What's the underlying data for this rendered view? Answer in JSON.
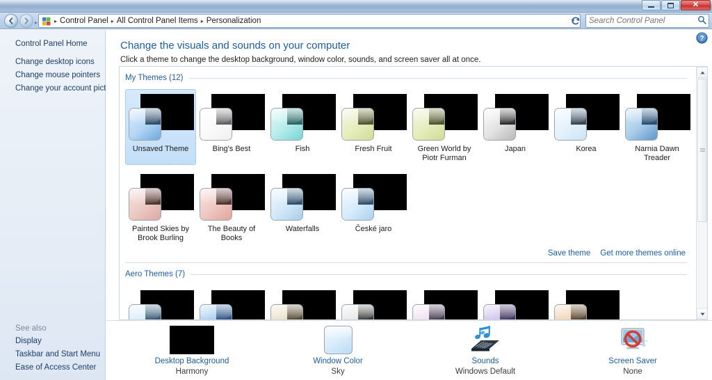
{
  "window": {
    "minimize_label": "Minimize",
    "maximize_label": "Maximize",
    "close_label": "Close"
  },
  "nav": {
    "back_label": "Back",
    "forward_label": "Forward",
    "refresh_label": "Refresh",
    "dropdown_label": "Previous locations",
    "breadcrumb": [
      "Control Panel",
      "All Control Panel Items",
      "Personalization"
    ],
    "separator": "▸"
  },
  "search": {
    "placeholder": "Search Control Panel",
    "value": "",
    "icon": "search-icon"
  },
  "sidebar": {
    "home_label": "Control Panel Home",
    "items": [
      {
        "label": "Change desktop icons"
      },
      {
        "label": "Change mouse pointers"
      },
      {
        "label": "Change your account picture"
      }
    ],
    "see_also_heading": "See also",
    "see_also": [
      {
        "label": "Display"
      },
      {
        "label": "Taskbar and Start Menu"
      },
      {
        "label": "Ease of Access Center"
      }
    ]
  },
  "main": {
    "title": "Change the visuals and sounds on your computer",
    "subtitle": "Click a theme to change the desktop background, window color, sounds, and screen saver all at once.",
    "help_label": "Help",
    "sections": [
      {
        "id": "my-themes",
        "heading": "My Themes (12)",
        "rows": [
          [
            {
              "name": "Unsaved Theme",
              "selected": true,
              "color_light": "#dcebfb",
              "color_mid": "#b5d6f5",
              "color_deep": "#6fa8dc",
              "dark_top": "#7d95ac",
              "dark_bottom": "#2e4a66"
            },
            {
              "name": "Bing's Best",
              "selected": false,
              "color_light": "#ffffff",
              "color_mid": "#fafafa",
              "color_deep": "#f0f0f0",
              "dark_top": "#b9b9b9",
              "dark_bottom": "#5c5c5c"
            },
            {
              "name": "Fish",
              "selected": false,
              "color_light": "#e4f8f8",
              "color_mid": "#b8ecec",
              "color_deep": "#76d6d4",
              "dark_top": "#79b5b2",
              "dark_bottom": "#29615f"
            },
            {
              "name": "Fresh Fruit",
              "selected": false,
              "color_light": "#f3f6de",
              "color_mid": "#e6edbf",
              "color_deep": "#d2dd96",
              "dark_top": "#9fa472",
              "dark_bottom": "#4e5130"
            },
            {
              "name": "Green World by Piotr Furman",
              "selected": false,
              "color_light": "#f2f5dc",
              "color_mid": "#e5edbd",
              "color_deep": "#d0dc94",
              "dark_top": "#9ea371",
              "dark_bottom": "#4d5030"
            },
            {
              "name": "Japan",
              "selected": false,
              "color_light": "#fafafa",
              "color_mid": "#e3e3e3",
              "color_deep": "#b9b9b9",
              "dark_top": "#9a9a9a",
              "dark_bottom": "#272727"
            },
            {
              "name": "Korea",
              "selected": false,
              "color_light": "#f4fafe",
              "color_mid": "#e4f1fb",
              "color_deep": "#cbe4f7",
              "dark_top": "#8fa4b6",
              "dark_bottom": "#313f4c"
            },
            {
              "name": "Narnia Dawn Treader",
              "selected": false,
              "color_light": "#d6e8f8",
              "color_mid": "#a9cdea",
              "color_deep": "#5f96c9",
              "dark_top": "#7196b5",
              "dark_bottom": "#28486a"
            }
          ],
          [
            {
              "name": "Painted Skies by Brook Burling",
              "selected": false,
              "color_light": "#f6e3e0",
              "color_mid": "#eccac4",
              "color_deep": "#dba9a2",
              "dark_top": "#9c7d77",
              "dark_bottom": "#4c332e"
            },
            {
              "name": "The Beauty of Books",
              "selected": false,
              "color_light": "#f8e4e2",
              "color_mid": "#efc8c3",
              "color_deep": "#e0a49c",
              "dark_top": "#9b7b75",
              "dark_bottom": "#4a312c"
            },
            {
              "name": "Waterfalls",
              "selected": false,
              "color_light": "#eef7fe",
              "color_mid": "#d4e9fa",
              "color_deep": "#a9cdea",
              "dark_top": "#7e9cb5",
              "dark_bottom": "#2f4c66"
            },
            {
              "name": "České jaro",
              "selected": false,
              "color_light": "#eef7fe",
              "color_mid": "#d8ecfb",
              "color_deep": "#aed0ed",
              "dark_top": "#7f9db6",
              "dark_bottom": "#304d67"
            }
          ]
        ]
      },
      {
        "id": "aero-themes",
        "heading": "Aero Themes (7)",
        "rows": [
          [
            {
              "name": "",
              "selected": false,
              "color_light": "#eef7fe",
              "color_mid": "#d5eafb",
              "color_deep": "#a8cdea",
              "dark_top": "#7d9bb4",
              "dark_bottom": "#2f4c66"
            },
            {
              "name": "",
              "selected": false,
              "color_light": "#d5e8fa",
              "color_mid": "#9cc6ec",
              "color_deep": "#3f7fc4",
              "dark_top": "#6b94bd",
              "dark_bottom": "#1f4675"
            },
            {
              "name": "",
              "selected": false,
              "color_light": "#f4efe0",
              "color_mid": "#e6dcc2",
              "color_deep": "#cfc19c",
              "dark_top": "#9b8f74",
              "dark_bottom": "#463c28"
            },
            {
              "name": "",
              "selected": false,
              "color_light": "#f6f6f6",
              "color_mid": "#e2e2e2",
              "color_deep": "#bcbcbc",
              "dark_top": "#9c9c9c",
              "dark_bottom": "#2a2a2a"
            },
            {
              "name": "",
              "selected": false,
              "color_light": "#f7f1f8",
              "color_mid": "#ecdcee",
              "color_deep": "#d4bcd9",
              "dark_top": "#8d7d93",
              "dark_bottom": "#3b3042"
            },
            {
              "name": "",
              "selected": false,
              "color_light": "#e6ddf4",
              "color_mid": "#cdbbe8",
              "color_deep": "#9f7fce",
              "dark_top": "#7c6a9b",
              "dark_bottom": "#362a4e"
            },
            {
              "name": "",
              "selected": false,
              "color_light": "#f7e7d4",
              "color_mid": "#edcfae",
              "color_deep": "#ddb184",
              "dark_top": "#9d8164",
              "dark_bottom": "#4a3722"
            }
          ]
        ]
      }
    ],
    "theme_links": [
      {
        "label": "Save theme"
      },
      {
        "label": "Get more themes online"
      }
    ]
  },
  "bottombar": [
    {
      "id": "desktop-background",
      "title": "Desktop Background",
      "value": "Harmony",
      "icon": "picture-icon"
    },
    {
      "id": "window-color",
      "title": "Window Color",
      "value": "Sky",
      "icon": "color-swatch-icon"
    },
    {
      "id": "sounds",
      "title": "Sounds",
      "value": "Windows Default",
      "icon": "sound-notes-icon"
    },
    {
      "id": "screen-saver",
      "title": "Screen Saver",
      "value": "None",
      "icon": "monitor-blocked-icon"
    }
  ],
  "scrollbar": {
    "up_label": "Scroll up",
    "down_label": "Scroll down",
    "thumb_label": "Scroll thumb"
  },
  "colors": {
    "accent_link": "#1c5ca6",
    "title_text": "#1c5ca6",
    "selection_bg": "#c3dff8",
    "close_red": "#c1302c"
  }
}
